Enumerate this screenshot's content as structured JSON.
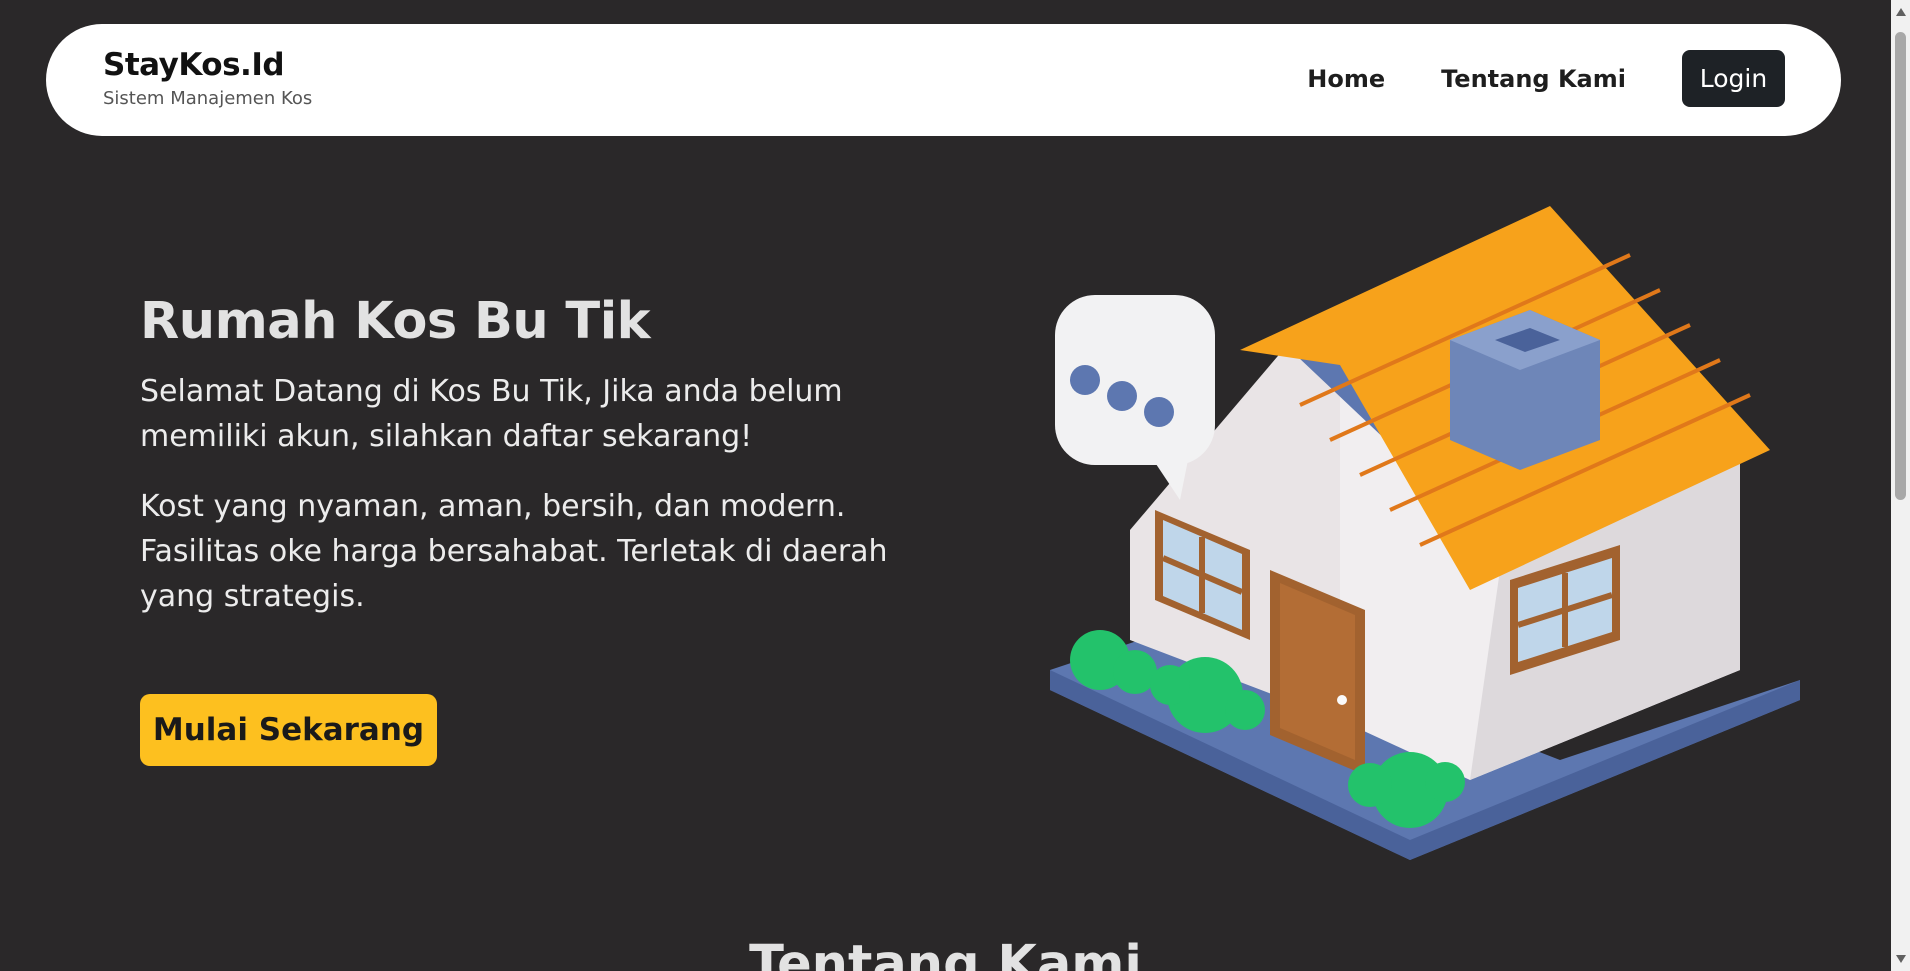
{
  "brand": {
    "title": "StayKos.Id",
    "subtitle": "Sistem Manajemen Kos"
  },
  "nav": {
    "home": "Home",
    "about": "Tentang Kami",
    "login": "Login"
  },
  "hero": {
    "title": "Rumah Kos Bu Tik",
    "paragraph1": "Selamat Datang di Kos Bu Tik, Jika anda belum memiliki akun, silahkan daftar sekarang!",
    "paragraph2": "Kost yang nyaman, aman, bersih, dan modern. Fasilitas oke harga bersahabat. Terletak di daerah yang strategis.",
    "cta": "Mulai Sekarang",
    "illustration_icon": "house-icon"
  },
  "section": {
    "title": "Tentang Kami"
  },
  "colors": {
    "background": "#2a2829",
    "cta": "#fdc01f",
    "login": "#1e2226",
    "roof": "#f7a21b",
    "base": "#5d77b0",
    "bush": "#23c26b"
  }
}
